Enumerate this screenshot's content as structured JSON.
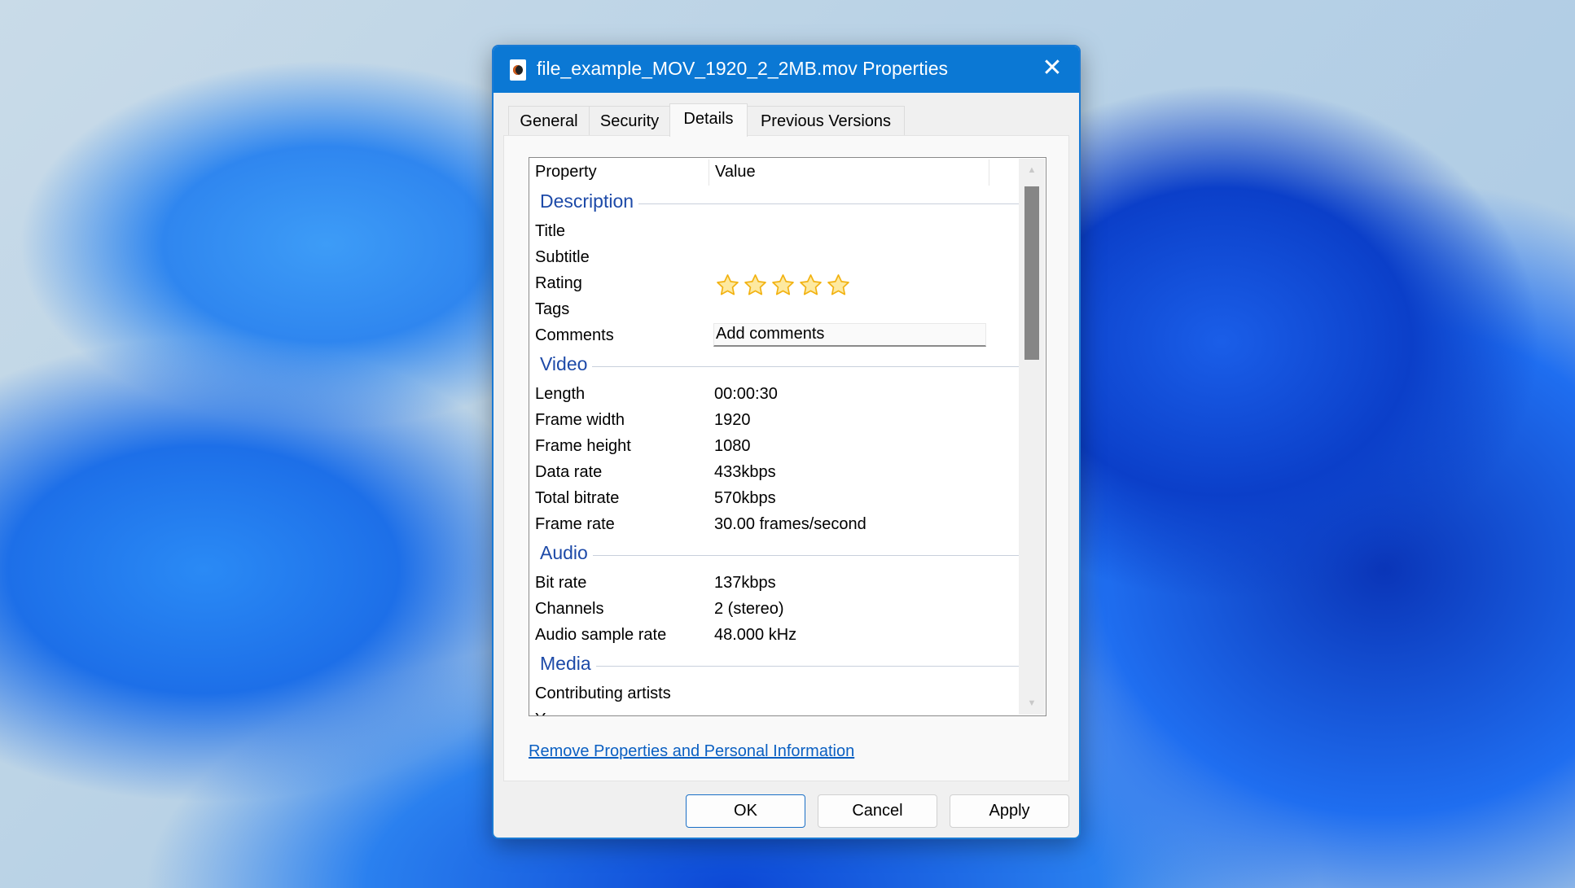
{
  "window": {
    "title": "file_example_MOV_1920_2_2MB.mov Properties",
    "icon": "video-file-icon",
    "close_icon": "close-icon",
    "accent": "#0b78d4"
  },
  "tabs": [
    {
      "label": "General",
      "active": false
    },
    {
      "label": "Security",
      "active": false
    },
    {
      "label": "Details",
      "active": true
    },
    {
      "label": "Previous Versions",
      "active": false
    }
  ],
  "details": {
    "columns": [
      "Property",
      "Value"
    ],
    "groups": [
      {
        "name": "Description",
        "rows": [
          {
            "key": "Title",
            "value": ""
          },
          {
            "key": "Subtitle",
            "value": ""
          },
          {
            "key": "Rating",
            "value": "",
            "type": "rating",
            "rating": 0,
            "max": 5
          },
          {
            "key": "Tags",
            "value": ""
          },
          {
            "key": "Comments",
            "value": "Add comments",
            "type": "input"
          }
        ]
      },
      {
        "name": "Video",
        "rows": [
          {
            "key": "Length",
            "value": "00:00:30"
          },
          {
            "key": "Frame width",
            "value": "1920"
          },
          {
            "key": "Frame height",
            "value": "1080"
          },
          {
            "key": "Data rate",
            "value": "433kbps"
          },
          {
            "key": "Total bitrate",
            "value": "570kbps"
          },
          {
            "key": "Frame rate",
            "value": "30.00 frames/second"
          }
        ]
      },
      {
        "name": "Audio",
        "rows": [
          {
            "key": "Bit rate",
            "value": "137kbps"
          },
          {
            "key": "Channels",
            "value": "2 (stereo)"
          },
          {
            "key": "Audio sample rate",
            "value": "48.000 kHz"
          }
        ]
      },
      {
        "name": "Media",
        "rows": [
          {
            "key": "Contributing artists",
            "value": ""
          },
          {
            "key": "Year",
            "value": ""
          }
        ]
      }
    ],
    "scroll_position": 0
  },
  "link": "Remove Properties and Personal Information",
  "buttons": {
    "ok": "OK",
    "cancel": "Cancel",
    "apply": "Apply"
  }
}
